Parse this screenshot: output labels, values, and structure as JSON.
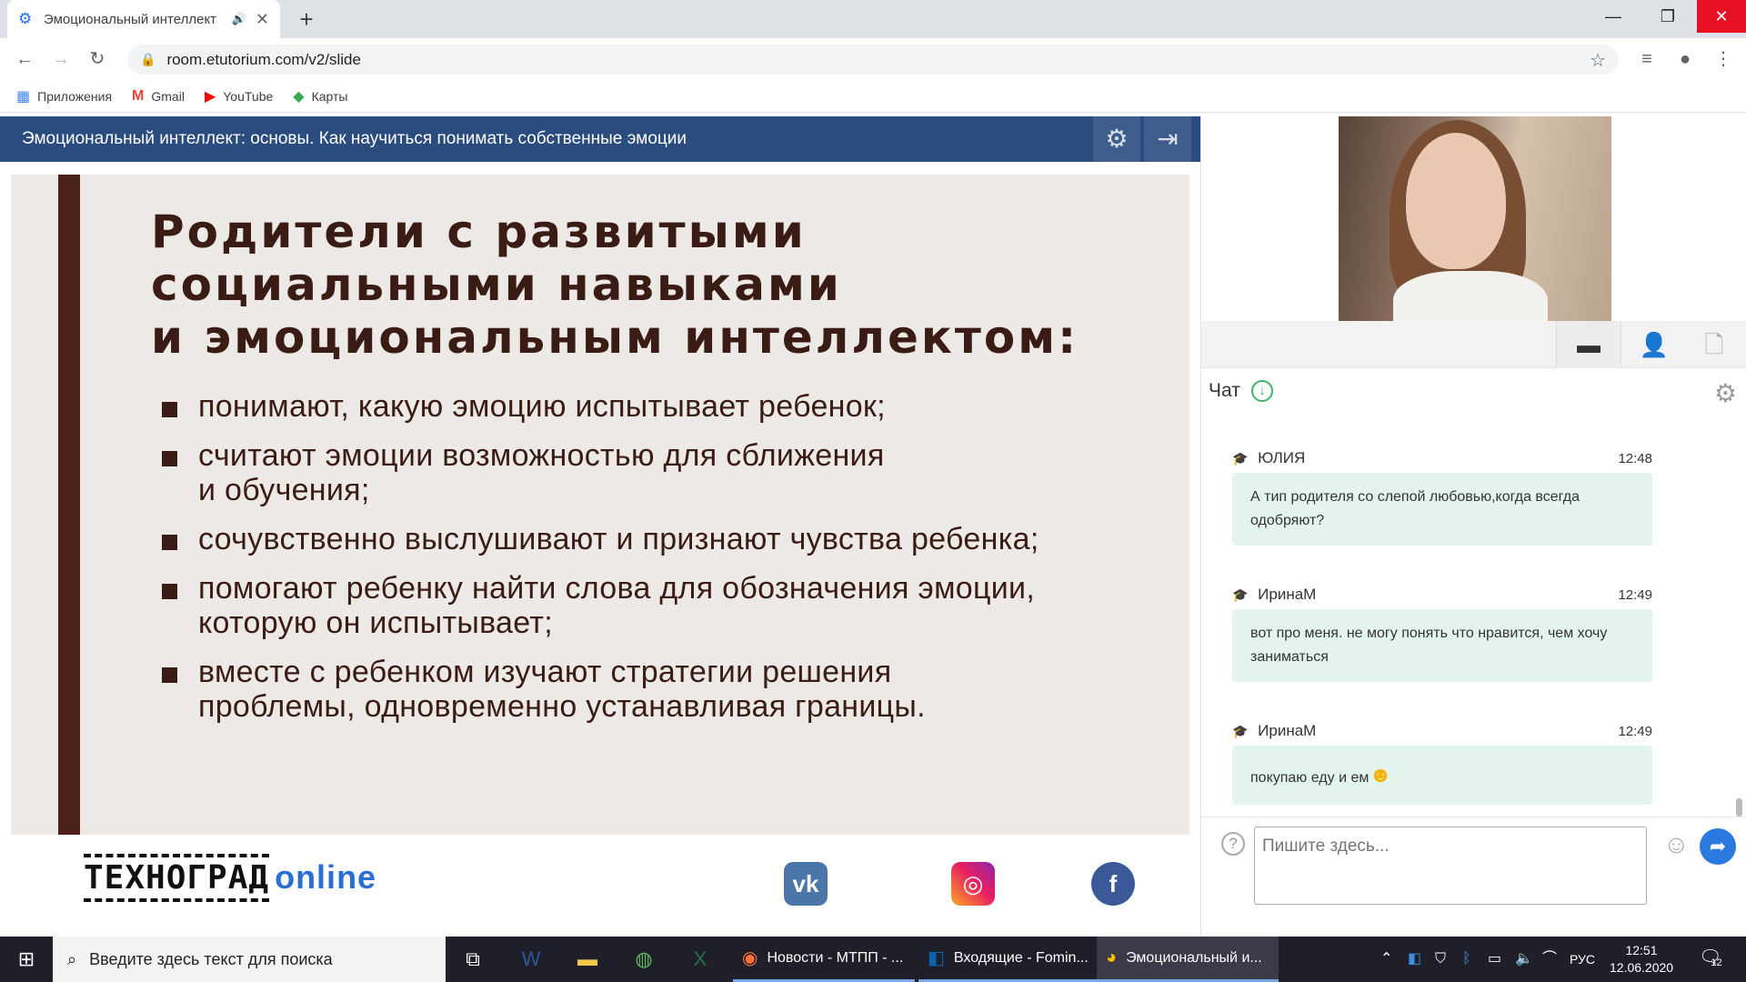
{
  "browser": {
    "tab_title": "Эмоциональный интеллект",
    "url": "room.etutorium.com/v2/slide",
    "bookmarks": [
      {
        "label": "Приложения",
        "icon": "apps-grid-icon",
        "color": "#4285f4"
      },
      {
        "label": "Gmail",
        "icon": "gmail-icon",
        "color": "#ea4335"
      },
      {
        "label": "YouTube",
        "icon": "youtube-icon",
        "color": "#ff0000"
      },
      {
        "label": "Карты",
        "icon": "maps-icon",
        "color": "#34a853"
      }
    ]
  },
  "webinar": {
    "title": "Эмоциональный интеллект: основы. Как научиться понимать собственные эмоции",
    "slide": {
      "title_lines": [
        "Родители с развитыми",
        "социальными навыками",
        "и эмоциональным интеллектом:"
      ],
      "bullets": [
        "понимают, какую эмоцию испытывает ребенок;",
        "считают эмоции возможностью для сближения и обучения;",
        "сочувственно выслушивают и признают чувства ребенка;",
        "помогают ребенку найти слова для обозначения эмоции, которую он испытывает;",
        "вместе с ребенком изучают стратегии решения проблемы, одновременно устанавливая границы."
      ]
    },
    "footer": {
      "logo_main": "ТЕХНОГРАД",
      "logo_suffix": "online",
      "socials": [
        {
          "label": "VK",
          "icon": "vk-icon"
        },
        {
          "label": "Instagram",
          "icon": "instagram-icon"
        },
        {
          "label": "Facebook",
          "icon": "facebook-icon"
        }
      ]
    }
  },
  "chat": {
    "header": "Чат",
    "messages": [
      {
        "author": "ЮЛИЯ",
        "time": "12:48",
        "text": "А тип родителя со слепой любовью,когда всегда одобряют?"
      },
      {
        "author": "ИринаМ",
        "time": "12:49",
        "text": "вот про меня. не могу понять что нравится, чем хочу заниматься"
      },
      {
        "author": "ИринаМ",
        "time": "12:49",
        "text": "покупаю еду и ем"
      }
    ],
    "input_placeholder": "Пишите здесь..."
  },
  "taskbar": {
    "search_placeholder": "Введите здесь текст для поиска",
    "windows": [
      {
        "label": "Новости - МТПП - ...",
        "icon": "firefox-icon"
      },
      {
        "label": "Входящие - Fomin...",
        "icon": "outlook-icon"
      },
      {
        "label": "Эмоциональный и...",
        "icon": "chrome-icon"
      }
    ],
    "language": "РУС",
    "time": "12:51",
    "date": "12.06.2020",
    "notification_count": "12"
  },
  "colors": {
    "header_blue": "#2b4c7e",
    "slide_brown": "#3a1c14",
    "chat_bubble": "#e3f4ee",
    "send_blue": "#2a7ae2"
  }
}
